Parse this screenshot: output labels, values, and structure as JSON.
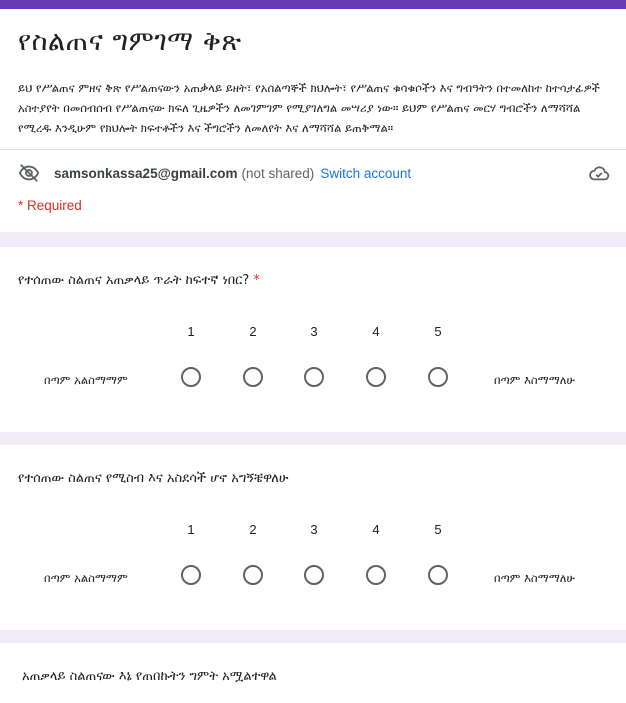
{
  "form": {
    "title": "የስልጠና ግምገማ ቅጽ",
    "description": "ይህ የሥልጠና ምዘና ቅጽ የሥልጠናውን አጠቃላይ ይዘት፣ የአሰልጣኞች ክህሎት፣ የሥልጠና ቁሳቁሶችን እና ግብዓትን በተመለከተ ከተሳታፊዎች አስተያየት በመሰብሰብ የሥልጠናው ክፍለ ጊዜዎችን ለመገምገም የሚያገለግል መሣሪያ ነው። ይህም የሥልጠና መርሃ ግብሮችን ለማሻሻል የሚረዱ እንዲሁም የክህሎት ክፍተቶችን እና ችግሮችን ለመለየት እና ለማሻሻል ይጠቅማል።"
  },
  "account": {
    "email": "samsonkassa25@gmail.com",
    "not_shared": "(not shared)",
    "switch_label": "Switch account"
  },
  "required_note": "* Required",
  "questions": [
    {
      "title": "የተሰጠው ስልጠና አጠቃላይ ጥራት ከፍተኛ ነበር?",
      "required": "*",
      "scale": [
        "1",
        "2",
        "3",
        "4",
        "5"
      ],
      "low_label": "በጣም አልስማማም",
      "high_label": "በጣም እስማማለሁ"
    },
    {
      "title": "የተሰጠው ስልጠና የሚስብ እና አስደሳች ሆኖ አግኝቼዋለሁ",
      "scale": [
        "1",
        "2",
        "3",
        "4",
        "5"
      ],
      "low_label": "በጣም አልስማማም",
      "high_label": "በጣም እስማማለሁ"
    },
    {
      "title": "አጠቃላይ ስልጠናው እኔ የጠበኩትን ግምት አሟልተዋል"
    }
  ],
  "icons": {
    "eye_off": "eye-off-icon",
    "cloud": "cloud-check-icon"
  },
  "colors": {
    "accent": "#673ab7",
    "background": "#f0ebf8",
    "link": "#1a73e8",
    "required": "#d93025"
  }
}
